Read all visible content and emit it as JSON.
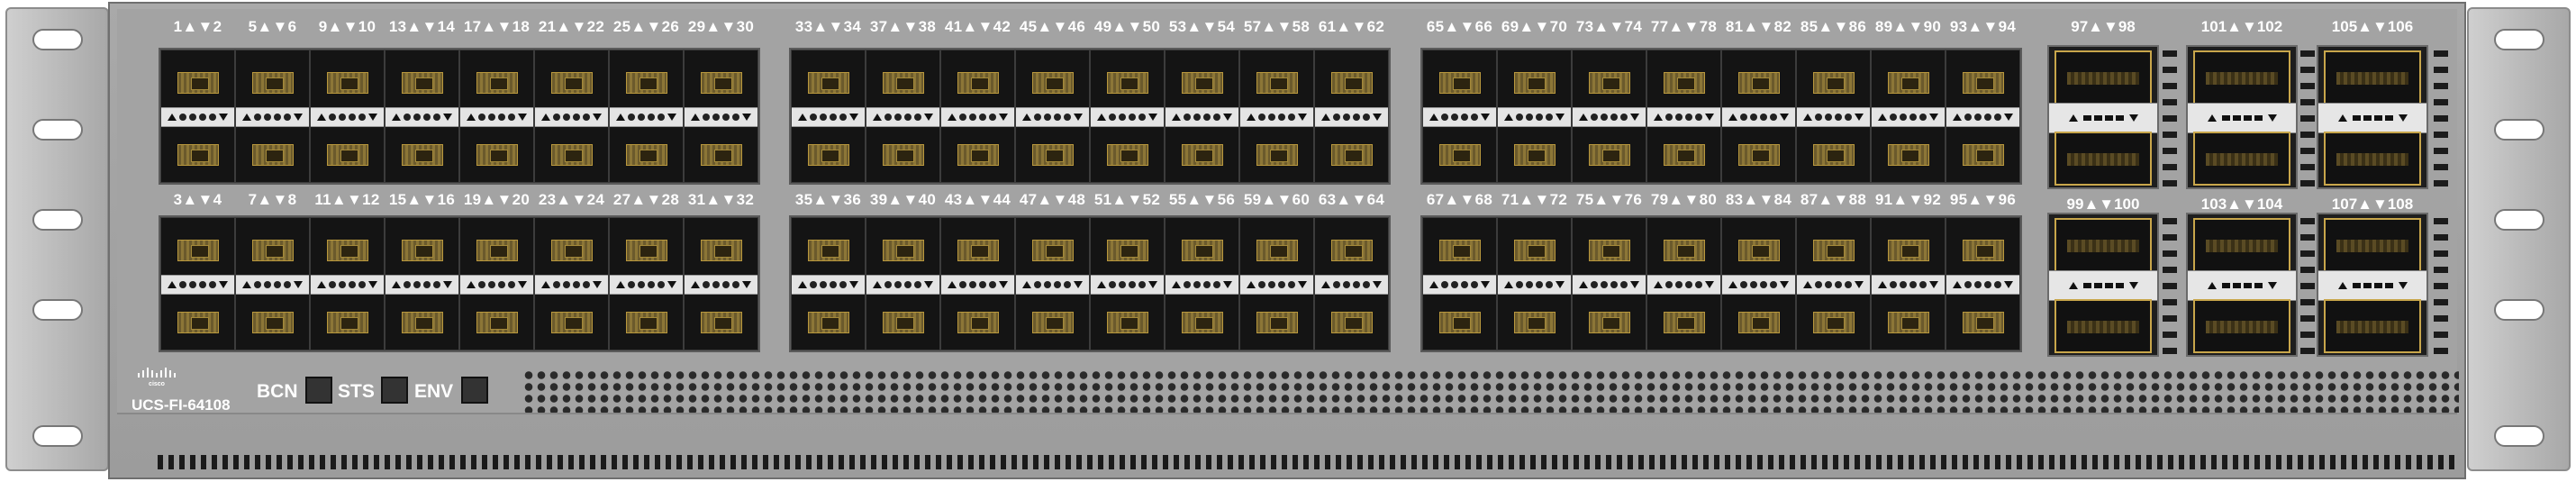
{
  "device": {
    "model": "UCS-FI-64108",
    "brand": "cisco",
    "brand_color": "#ffffff",
    "face_color": "#a3a3a3"
  },
  "status_indicators": [
    {
      "label": "BCN"
    },
    {
      "label": "STS"
    },
    {
      "label": "ENV"
    }
  ],
  "sfp_groups": [
    {
      "top_labels": [
        "1▲▼2",
        "5▲▼6",
        "9▲▼10",
        "13▲▼14",
        "17▲▼18",
        "21▲▼22",
        "25▲▼26",
        "29▲▼30"
      ],
      "bottom_labels": [
        "3▲▼4",
        "7▲▼8",
        "11▲▼12",
        "15▲▼16",
        "19▲▼20",
        "23▲▼24",
        "27▲▼28",
        "31▲▼32"
      ]
    },
    {
      "top_labels": [
        "33▲▼34",
        "37▲▼38",
        "41▲▼42",
        "45▲▼46",
        "49▲▼50",
        "53▲▼54",
        "57▲▼58",
        "61▲▼62"
      ],
      "bottom_labels": [
        "35▲▼36",
        "39▲▼40",
        "43▲▼44",
        "47▲▼48",
        "51▲▼52",
        "55▲▼56",
        "59▲▼60",
        "63▲▼64"
      ]
    },
    {
      "top_labels": [
        "65▲▼66",
        "69▲▼70",
        "73▲▼74",
        "77▲▼78",
        "81▲▼82",
        "85▲▼86",
        "89▲▼90",
        "93▲▼94"
      ],
      "bottom_labels": [
        "67▲▼68",
        "71▲▼72",
        "75▲▼76",
        "79▲▼80",
        "83▲▼84",
        "87▲▼88",
        "91▲▼92",
        "95▲▼96"
      ]
    }
  ],
  "qsfp_groups": [
    {
      "top_label": "97▲▼98",
      "bottom_label": "99▲▼100"
    },
    {
      "top_label": "101▲▼102",
      "bottom_label": "103▲▼104"
    },
    {
      "top_label": "105▲▼106",
      "bottom_label": "107▲▼108"
    }
  ]
}
